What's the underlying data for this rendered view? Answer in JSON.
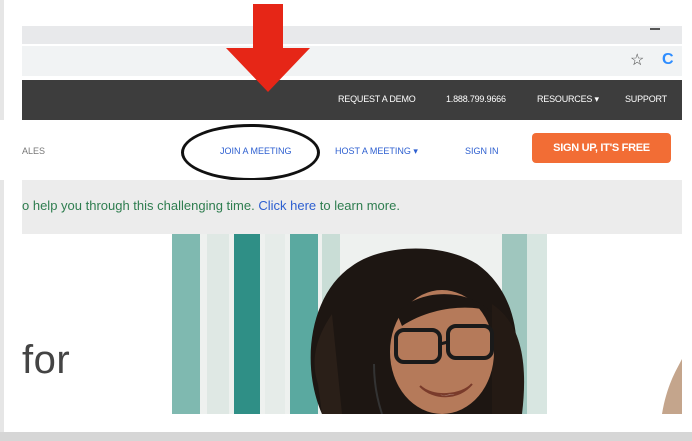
{
  "browser": {
    "star_icon": "star-icon",
    "extension_icon": "C"
  },
  "top_nav": {
    "request_demo": "REQUEST A DEMO",
    "phone": "1.888.799.9666",
    "resources": "RESOURCES ▾",
    "support": "SUPPORT"
  },
  "main_nav": {
    "sales": "ALES",
    "join_meeting": "JOIN A MEETING",
    "host_meeting": "HOST A MEETING ▾",
    "sign_in": "SIGN IN",
    "sign_up": "SIGN UP, IT'S FREE"
  },
  "banner": {
    "text_before": "o help you through this challenging time. ",
    "link": "Click here",
    "text_after": " to learn more."
  },
  "hero": {
    "heading": "for"
  },
  "colors": {
    "topnav_bg": "#3d3d3d",
    "link_blue": "#2d5fd0",
    "signup_orange": "#f26d35",
    "annotation_red": "#e62617"
  }
}
